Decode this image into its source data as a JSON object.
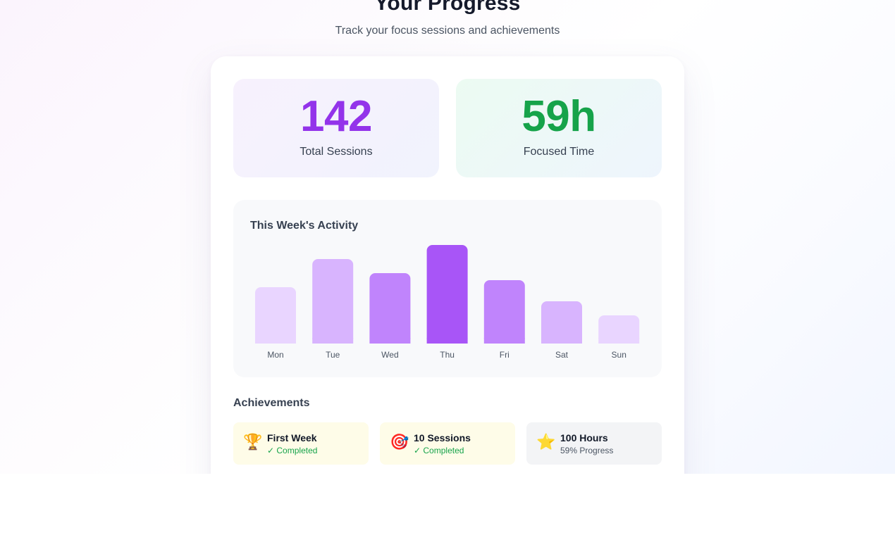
{
  "header": {
    "title": "Your Progress",
    "subtitle": "Track your focus sessions and achievements"
  },
  "stats": {
    "sessions": {
      "value": "142",
      "label": "Total Sessions"
    },
    "focused": {
      "value": "59h",
      "label": "Focused Time"
    }
  },
  "activity": {
    "title": "This Week's Activity"
  },
  "chart_data": {
    "type": "bar",
    "categories": [
      "Mon",
      "Tue",
      "Wed",
      "Thu",
      "Fri",
      "Sat",
      "Sun"
    ],
    "values": [
      4,
      6,
      5,
      7,
      4.5,
      3,
      2
    ],
    "colors": [
      "#e9d5ff",
      "#d8b4fe",
      "#c084fc",
      "#a855f7",
      "#c084fc",
      "#d8b4fe",
      "#e9d5ff"
    ],
    "ylim": [
      0,
      7
    ],
    "grid": false,
    "title": ""
  },
  "achievements": {
    "title": "Achievements",
    "items": [
      {
        "icon": "🏆",
        "icon_name": "trophy-icon",
        "name": "First Week",
        "status": "✓ Completed",
        "state": "done",
        "bg": "#fefce8"
      },
      {
        "icon": "🎯",
        "icon_name": "target-icon",
        "name": "10 Sessions",
        "status": "✓ Completed",
        "state": "done",
        "bg": "#fefce8"
      },
      {
        "icon": "⭐",
        "icon_name": "star-icon",
        "name": "100 Hours",
        "status": "59% Progress",
        "state": "pending",
        "bg": "#f3f4f6"
      }
    ]
  },
  "colors": {
    "accent": "#9333ea",
    "success": "#16a34a"
  }
}
